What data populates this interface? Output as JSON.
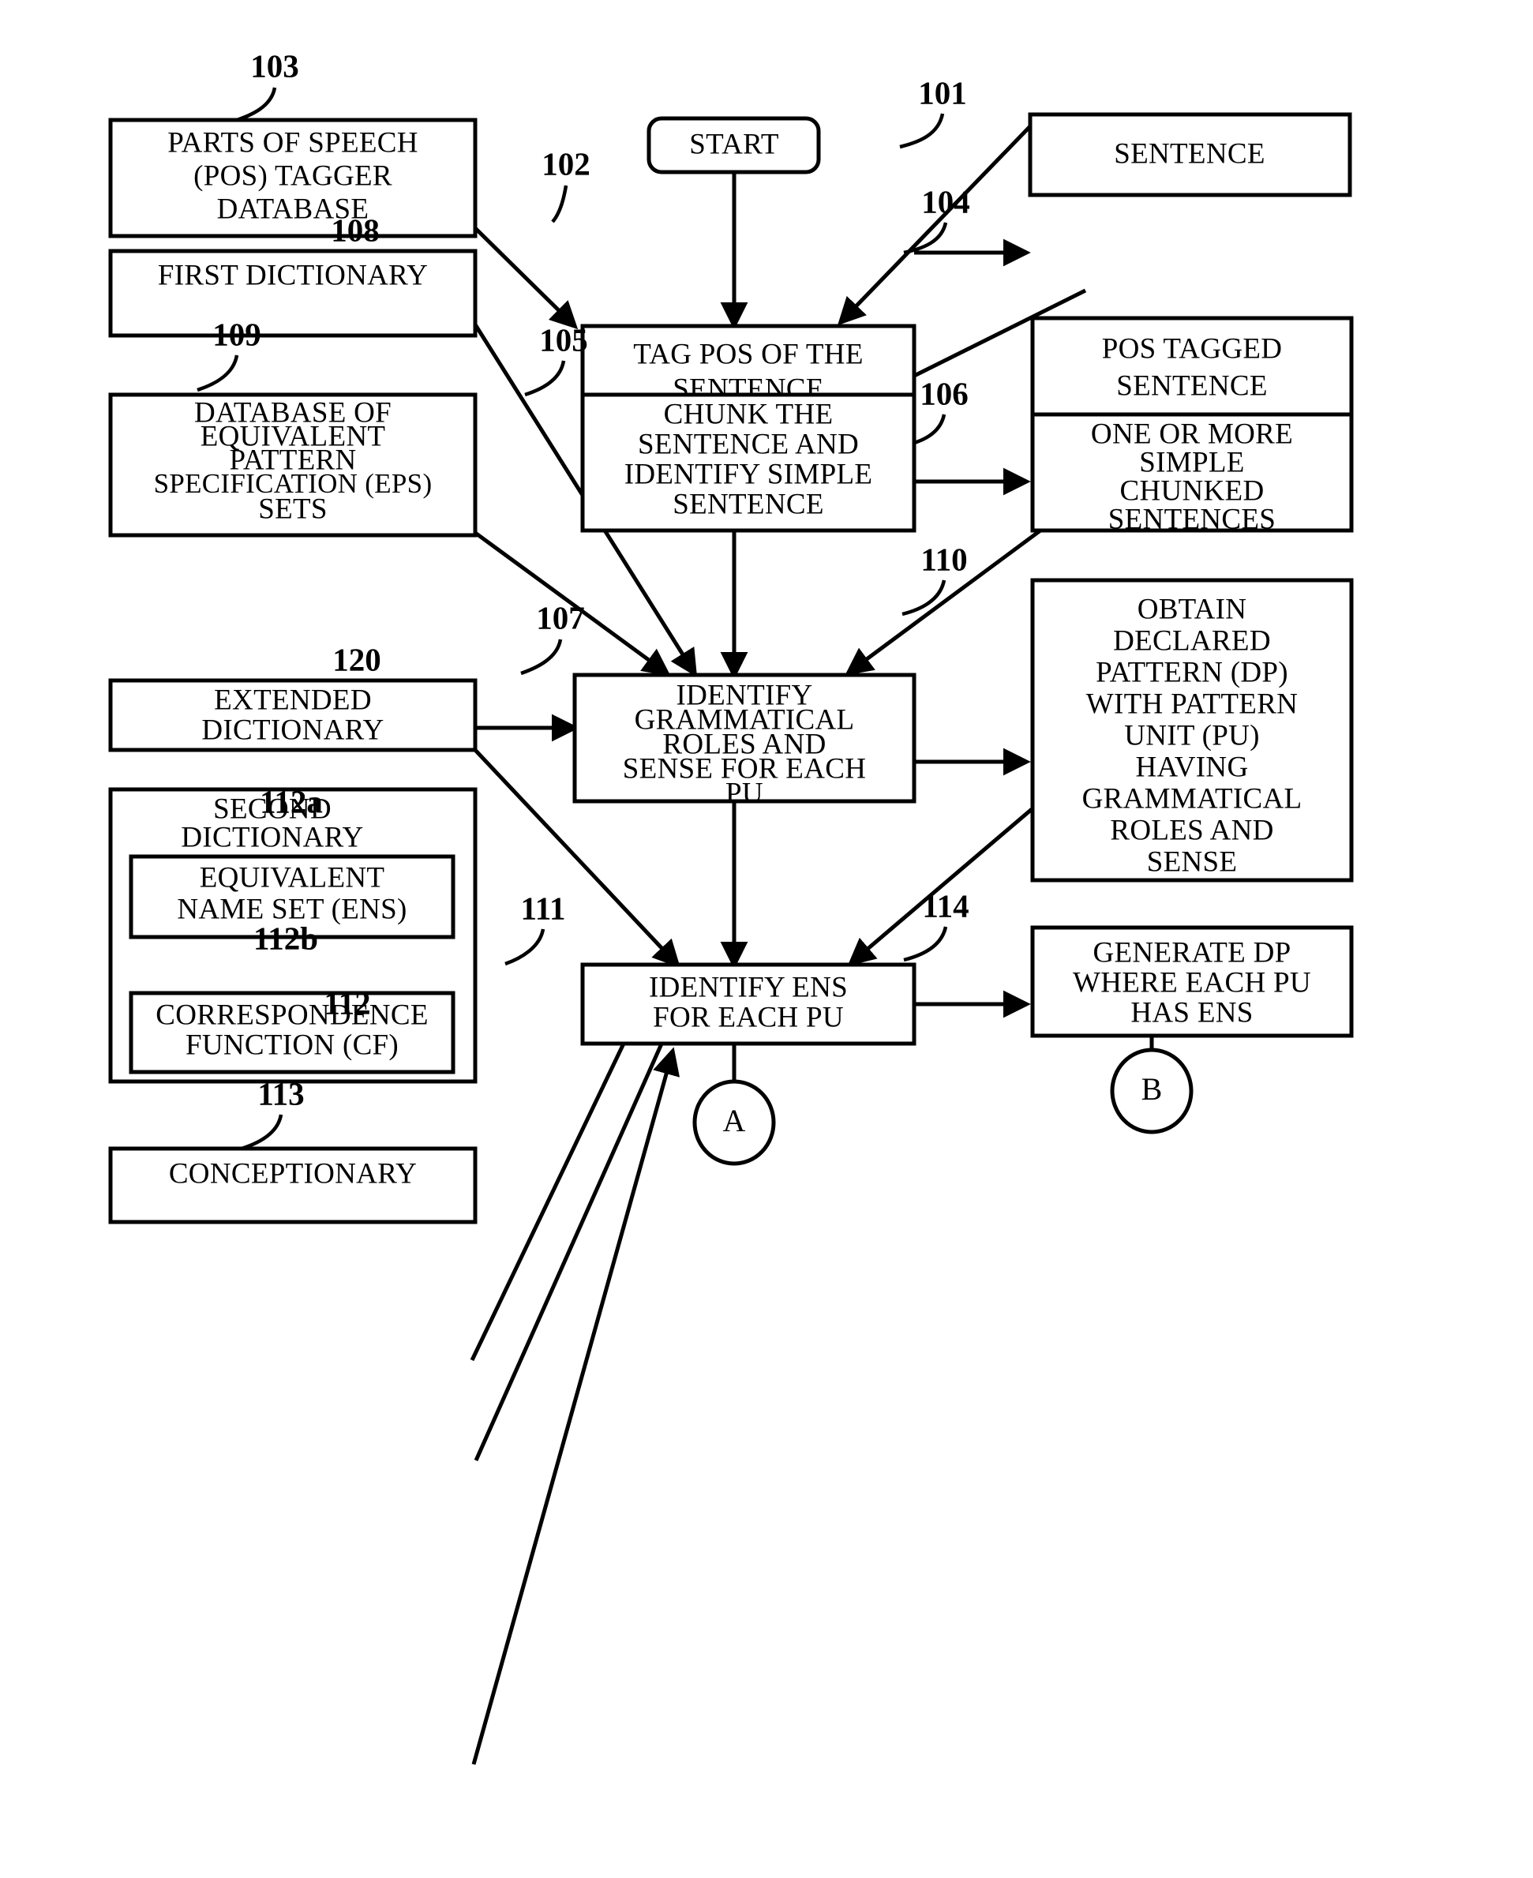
{
  "figure": {
    "type": "patent-flowchart",
    "background_color": "#ffffff",
    "line_color": "#000000"
  },
  "nodes": {
    "start": {
      "label": "START",
      "ref": ""
    },
    "sentence": {
      "label": "SENTENCE",
      "ref": "101"
    },
    "tag_pos": {
      "label_lines": [
        "TAG POS OF THE",
        "SENTENCE"
      ],
      "ref": "102"
    },
    "pos_tagger_db": {
      "label_lines": [
        "PARTS OF SPEECH",
        "(POS) TAGGER",
        "DATABASE"
      ],
      "ref": "103"
    },
    "pos_tagged_sentence": {
      "label_lines": [
        "POS TAGGED",
        "SENTENCE"
      ],
      "ref": "104"
    },
    "chunk": {
      "label_lines": [
        "CHUNK THE",
        "SENTENCE AND",
        "IDENTIFY SIMPLE",
        "SENTENCE"
      ],
      "ref": "105"
    },
    "chunked_sentences": {
      "label_lines": [
        "ONE OR MORE",
        "SIMPLE",
        "CHUNKED",
        "SENTENCES"
      ],
      "ref": "106"
    },
    "identify_roles": {
      "label_lines": [
        "IDENTIFY",
        "GRAMMATICAL",
        "ROLES AND",
        "SENSE FOR EACH",
        "PU"
      ],
      "ref": "107"
    },
    "first_dictionary": {
      "label": "FIRST DICTIONARY",
      "ref": "108"
    },
    "eps_database": {
      "label_lines": [
        "DATABASE OF",
        "EQUIVALENT",
        "PATTERN",
        "SPECIFICATION (EPS)",
        "SETS"
      ],
      "ref": "109"
    },
    "obtain_dp": {
      "label_lines": [
        "OBTAIN",
        "DECLARED",
        "PATTERN (DP)",
        "WITH PATTERN",
        "UNIT (PU)",
        "HAVING",
        "GRAMMATICAL",
        "ROLES AND",
        "SENSE"
      ],
      "ref": "110"
    },
    "identify_ens": {
      "label_lines": [
        "IDENTIFY ENS",
        "FOR EACH PU"
      ],
      "ref": "111"
    },
    "second_dictionary": {
      "label_lines": [
        "SECOND",
        "DICTIONARY"
      ],
      "ref": "112"
    },
    "ens": {
      "label_lines": [
        "EQUIVALENT",
        "NAME SET (ENS)"
      ],
      "ref": "112a"
    },
    "cf": {
      "label_lines": [
        "CORRESPONDENCE",
        "FUNCTION (CF)"
      ],
      "ref": "112b"
    },
    "conceptionary": {
      "label": "CONCEPTIONARY",
      "ref": "113"
    },
    "generate_dp": {
      "label_lines": [
        "GENERATE DP",
        "WHERE EACH PU",
        "HAS ENS"
      ],
      "ref": "114"
    },
    "extended_dictionary": {
      "label_lines": [
        "EXTENDED",
        "DICTIONARY"
      ],
      "ref": "120"
    }
  },
  "connectors": {
    "a": {
      "label": "A"
    },
    "b": {
      "label": "B"
    }
  },
  "reference_numerals": [
    "101",
    "102",
    "103",
    "104",
    "105",
    "106",
    "107",
    "108",
    "109",
    "110",
    "111",
    "112",
    "112a",
    "112b",
    "113",
    "114",
    "120"
  ]
}
